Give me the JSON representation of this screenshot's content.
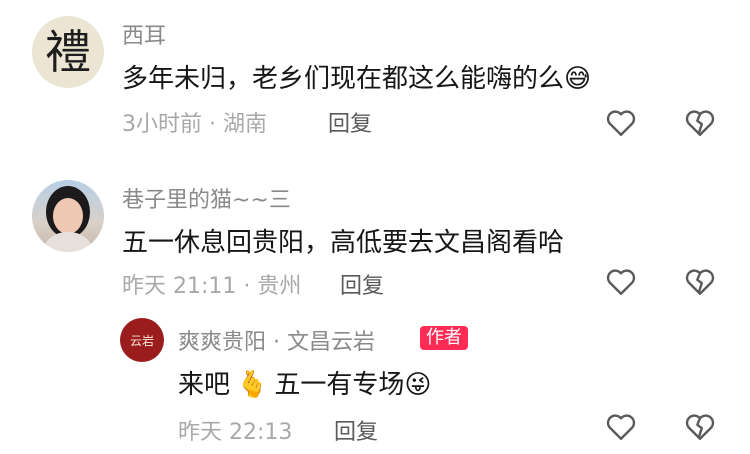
{
  "comments": [
    {
      "avatar_char": "禮",
      "name": "西耳",
      "text": "多年未归，老乡们现在都这么能嗨的么",
      "emoji": "😅",
      "time_location": "3小时前 · 湖南",
      "reply_label": "回复"
    },
    {
      "name": "巷子里的猫~~三",
      "text": "五一休息回贵阳，高低要去文昌阁看哈",
      "time_location": "昨天 21:11 · 贵州",
      "reply_label": "回复"
    }
  ],
  "reply": {
    "avatar_text": "云岩",
    "name": "爽爽贵阳 · 文昌云岩",
    "author_badge": "作者",
    "text_before": "来吧",
    "emoji1": "🫰",
    "text_after": "五一有专场",
    "emoji2": "😜",
    "time": "昨天 22:13",
    "reply_label": "回复"
  },
  "colors": {
    "badge": "#fe2c55",
    "name": "#8a8a8a",
    "text": "#161616",
    "meta": "#a8a8a8"
  },
  "icons": [
    "heart-outline-icon",
    "broken-heart-icon"
  ]
}
